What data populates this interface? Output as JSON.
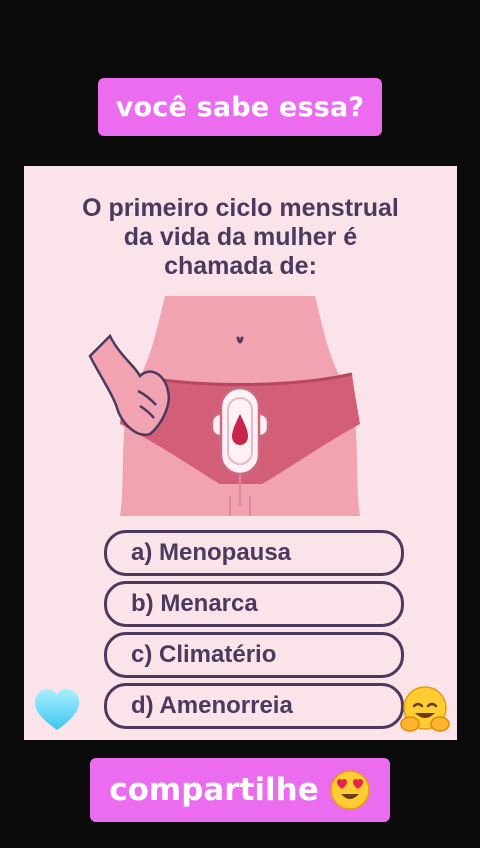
{
  "header": {
    "title": "você sabe essa?"
  },
  "quiz": {
    "question_lines": [
      "O primeiro ciclo menstrual",
      "da vida da mulher é",
      "chamada de:"
    ],
    "options": [
      {
        "label": "a) Menopausa"
      },
      {
        "label": "b) Menarca"
      },
      {
        "label": "c) Climatério"
      },
      {
        "label": "d) Amenorreia"
      }
    ]
  },
  "footer": {
    "cta": "compartilhe",
    "cta_emoji": "heart-eyes-emoji"
  },
  "icons": {
    "left": "light-blue-heart-icon",
    "right": "hugging-face-emoji-icon"
  },
  "colors": {
    "banner": "#ec6cf0",
    "card": "#fbe3ea",
    "text": "#4b3a5e",
    "skin": "#f1a3b2",
    "underwear": "#d25e78",
    "pad": "#fff2f4",
    "blood": "#c7264a"
  }
}
